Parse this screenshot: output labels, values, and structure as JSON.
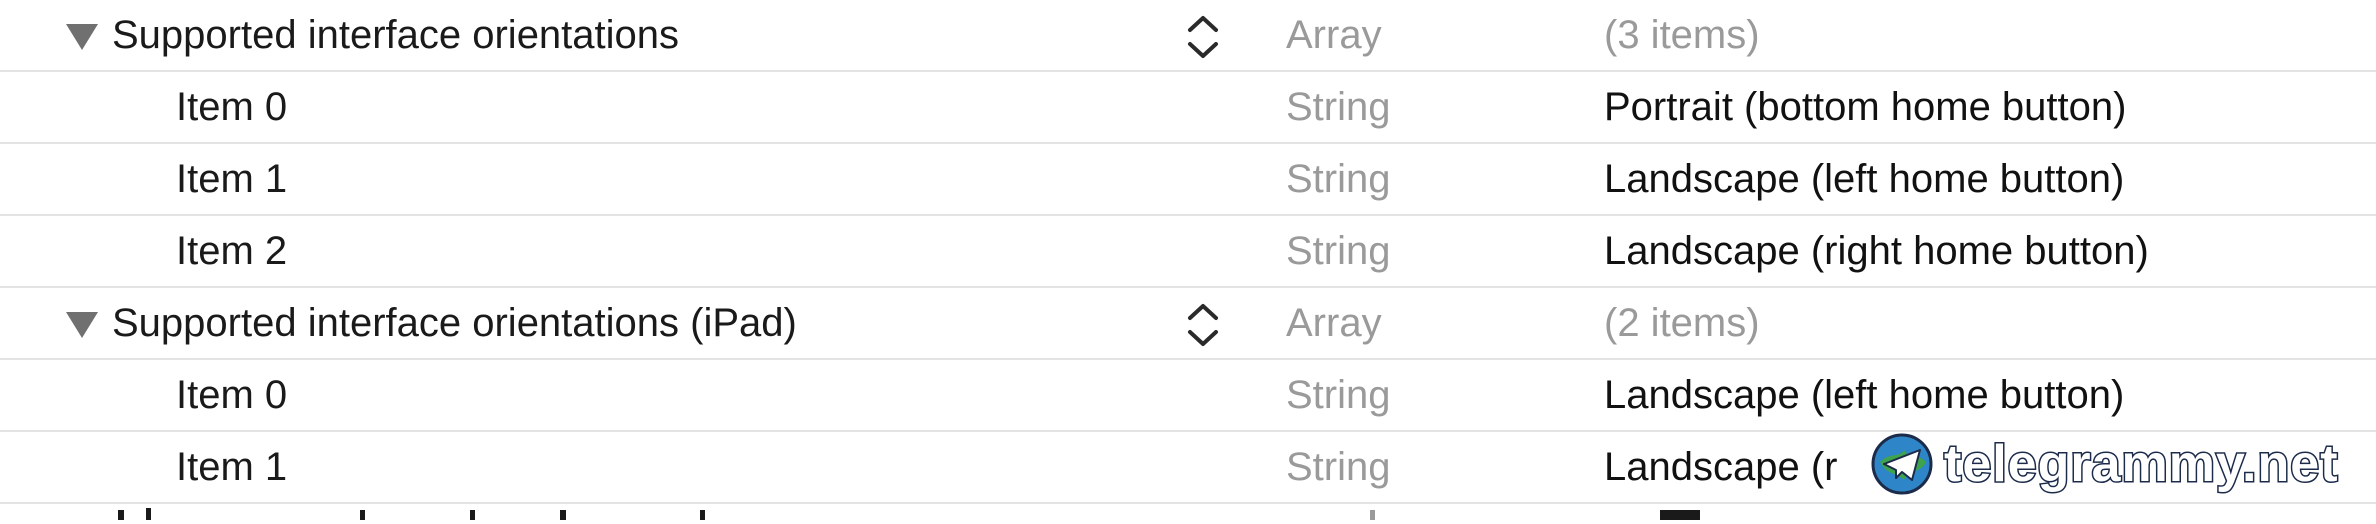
{
  "plist": {
    "rows": [
      {
        "key": "Supported interface orientations",
        "type": "Array",
        "value": "(3 items)"
      },
      {
        "key": "Item 0",
        "type": "String",
        "value": "Portrait (bottom home button)"
      },
      {
        "key": "Item 1",
        "type": "String",
        "value": "Landscape (left home button)"
      },
      {
        "key": "Item 2",
        "type": "String",
        "value": "Landscape (right home button)"
      },
      {
        "key": "Supported interface orientations (iPad)",
        "type": "Array",
        "value": "(2 items)"
      },
      {
        "key": "Item 0",
        "type": "String",
        "value": "Landscape (left home button)"
      },
      {
        "key": "Item 1",
        "type": "String",
        "value": "Landscape (r"
      }
    ]
  },
  "watermark": {
    "text": "telegrammy.net",
    "icon": "telegram-globe-icon"
  },
  "colors": {
    "type_gray": "#9a9a9a",
    "separator": "#e3e3e3",
    "triangle": "#707070"
  }
}
